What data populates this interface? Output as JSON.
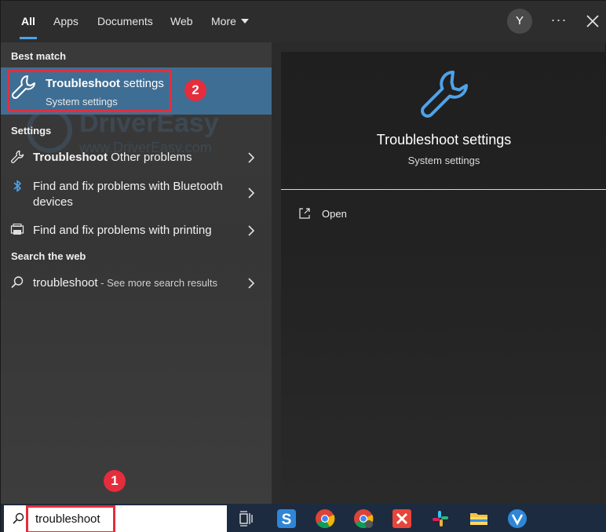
{
  "tabs": [
    {
      "label": "All",
      "active": true
    },
    {
      "label": "Apps"
    },
    {
      "label": "Documents"
    },
    {
      "label": "Web"
    },
    {
      "label": "More"
    }
  ],
  "account": {
    "initial": "Y"
  },
  "sections": {
    "best_match": "Best match",
    "settings": "Settings",
    "search_web": "Search the web"
  },
  "best_match": {
    "title_bold": "Troubleshoot",
    "title_rest": " settings",
    "subtitle": "System settings",
    "icon": "wrench-icon"
  },
  "settings_items": [
    {
      "bold": "Troubleshoot",
      "rest": " Other problems",
      "icon": "wrench-icon"
    },
    {
      "line1": "Find and fix problems with Bluetooth",
      "line2": "devices",
      "icon": "bluetooth-icon"
    },
    {
      "text": "Find and fix problems with printing",
      "icon": "printer-icon"
    }
  ],
  "web_item": {
    "query": "troubleshoot",
    "suffix": " - See more search results",
    "icon": "search-icon"
  },
  "preview": {
    "title": "Troubleshoot settings",
    "subtitle": "System settings",
    "open_label": "Open"
  },
  "search": {
    "value": "troubleshoot"
  },
  "annotations": {
    "step1": "1",
    "step2": "2"
  },
  "watermark": {
    "brand": "DriverEasy",
    "url": "www.DriverEasy.com"
  },
  "colors": {
    "accent": "#4ea2e8",
    "highlight": "#3f6e94",
    "annotation": "#e52d3c",
    "taskbar": "#1c2b3f"
  },
  "taskbar_icons": [
    "task-view-icon",
    "snagit-icon",
    "chrome-icon",
    "chrome-canary-icon",
    "xmind-icon",
    "slack-icon",
    "file-explorer-icon",
    "vpn-icon"
  ]
}
